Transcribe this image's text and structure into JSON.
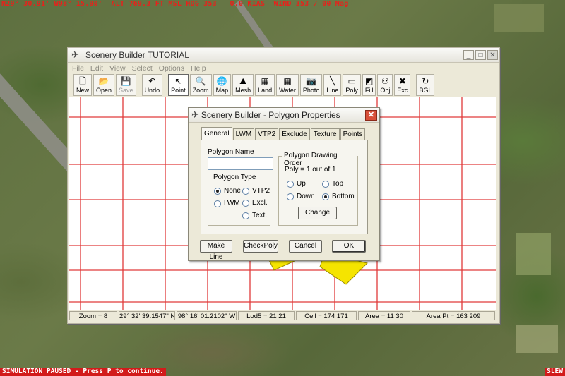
{
  "hud": {
    "top_text": "N29° 30.91' W98° 15.90'  ALT 769.3 FT MSL HDG 353   0.0 KIAS  WIND 353 / 00 Mag",
    "paused_text": "SIMULATION PAUSED - Press P to continue.",
    "slew_text": "SLEW"
  },
  "window": {
    "title": "Scenery Builder  TUTORIAL",
    "menu": [
      "File",
      "Edit",
      "View",
      "Select",
      "Options",
      "Help"
    ],
    "toolbar": [
      {
        "label": "New",
        "icon": "new-file-icon",
        "glyph": "🗋"
      },
      {
        "label": "Open",
        "icon": "open-folder-icon",
        "glyph": "📂"
      },
      {
        "label": "Save",
        "icon": "save-icon",
        "glyph": "💾",
        "disabled": true
      },
      {
        "label": "Undo",
        "icon": "undo-icon",
        "glyph": "↶"
      },
      {
        "label": "Point",
        "icon": "pointer-icon",
        "glyph": "↖",
        "pressed": true
      },
      {
        "label": "Zoom",
        "icon": "zoom-icon",
        "glyph": "🔍"
      },
      {
        "label": "Map",
        "icon": "globe-icon",
        "glyph": "🌐"
      },
      {
        "label": "Mesh",
        "icon": "mesh-icon",
        "glyph": "⛰"
      },
      {
        "label": "Land",
        "icon": "land-icon",
        "glyph": "▦"
      },
      {
        "label": "Water",
        "icon": "water-icon",
        "glyph": "▦"
      },
      {
        "label": "Photo",
        "icon": "camera-icon",
        "glyph": "📷"
      },
      {
        "label": "Line",
        "icon": "line-icon",
        "glyph": "╲"
      },
      {
        "label": "Poly",
        "icon": "polygon-icon",
        "glyph": "▭"
      },
      {
        "label": "Fill",
        "icon": "fill-icon",
        "glyph": "◩"
      },
      {
        "label": "Obj",
        "icon": "object-icon",
        "glyph": "⚇"
      },
      {
        "label": "Exc",
        "icon": "exclude-icon",
        "glyph": "✖"
      },
      {
        "label": "BGL",
        "icon": "bgl-icon",
        "glyph": "↻"
      }
    ],
    "status": [
      "Zoom = 8",
      "29° 32' 39.1547\" N",
      "98° 16' 01.2102\" W",
      "Lod5 = 21 21",
      "Cell = 174 171",
      "Area = 11 30",
      "Area Pt = 163 209"
    ]
  },
  "dialog": {
    "title": "Scenery Builder - Polygon Properties",
    "tabs": [
      "General",
      "LWM",
      "VTP2",
      "Exclude",
      "Texture",
      "Points"
    ],
    "active_tab": "General",
    "polygon_name_label": "Polygon Name",
    "polygon_name_value": "",
    "polygon_type": {
      "title": "Polygon Type",
      "options": [
        "None",
        "VTP2",
        "LWM",
        "Excl.",
        "Text."
      ],
      "selected": "None"
    },
    "drawing_order": {
      "title": "Polygon Drawing Order",
      "info": "Poly = 1 out of 1",
      "options": [
        "Up",
        "Top",
        "Down",
        "Bottom"
      ],
      "selected": "Bottom",
      "change_label": "Change"
    },
    "buttons": {
      "make_line": "Make Line",
      "check_poly": "CheckPoly",
      "cancel": "Cancel",
      "ok": "OK"
    }
  },
  "colors": {
    "grid_line": "#e03a3a",
    "polygon_fill": "#f5e400",
    "hud_red": "#e8211b"
  }
}
